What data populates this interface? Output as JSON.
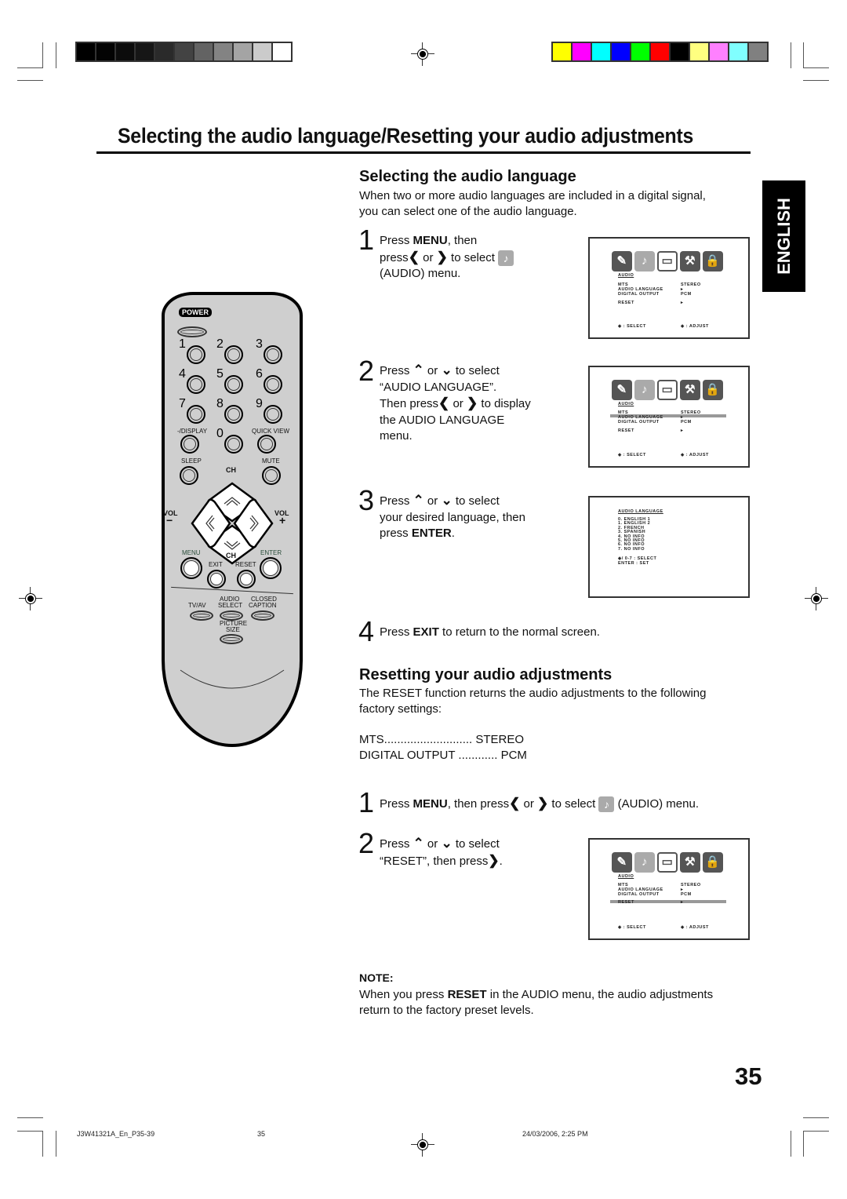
{
  "print_marks": {
    "grayscale_bar": [
      "#000000",
      "#030303",
      "#0c0c0c",
      "#161616",
      "#2a2a2a",
      "#434343",
      "#636363",
      "#838383",
      "#a4a4a4",
      "#cbcbcb",
      "#ffffff"
    ],
    "color_bar": [
      "#ffff00",
      "#ff00ff",
      "#00ffff",
      "#0000ff",
      "#00ff00",
      "#ff0000",
      "#000000",
      "#ffff80",
      "#ff80ff",
      "#80ffff",
      "#808080"
    ]
  },
  "page": {
    "title": "Selecting the audio language/Resetting your audio adjustments",
    "language_tab": "ENGLISH",
    "page_number": "35"
  },
  "section1": {
    "heading": "Selecting the audio language",
    "intro_line1": "When two or more audio languages are included in a digital signal,",
    "intro_line2": "you can select one of the audio language.",
    "steps": [
      {
        "num": "1",
        "l1a": "Press ",
        "l1b": "MENU",
        "l1c": ", then",
        "l2a": "press",
        "l2or": " or ",
        "l2b": " to select",
        "l3": "(AUDIO) menu."
      },
      {
        "num": "2",
        "l1a": "Press ",
        "l1or": " or ",
        "l1b": " to select",
        "l2": "“AUDIO LANGUAGE”.",
        "l3a": "Then press",
        "l3or": " or ",
        "l3b": " to display",
        "l4": "the AUDIO LANGUAGE",
        "l5": "menu."
      },
      {
        "num": "3",
        "l1a": "Press ",
        "l1or": " or ",
        "l1b": " to  select",
        "l2": "your desired language, then",
        "l3a": "press ",
        "l3b": "ENTER",
        "l3c": "."
      },
      {
        "num": "4",
        "l1a": "Press ",
        "l1b": "EXIT",
        "l1c": " to return to the normal screen."
      }
    ]
  },
  "section2": {
    "heading": "Resetting your audio adjustments",
    "intro_line1": "The RESET function returns the audio adjustments to the following",
    "intro_line2": "factory settings:",
    "settings": [
      {
        "name": "MTS",
        "dots": "...........................",
        "value": "STEREO"
      },
      {
        "name": "DIGITAL OUTPUT",
        "dots": " ............",
        "value": "PCM"
      }
    ],
    "steps": [
      {
        "num": "1",
        "a": "Press ",
        "b": "MENU",
        "c": ", then press",
        "or": " or ",
        "d": " to select ",
        "e": " (AUDIO) menu."
      },
      {
        "num": "2",
        "l1a": "Press ",
        "l1or": " or ",
        "l1b": " to select",
        "l2a": "“RESET”, then press",
        "l2b": "."
      }
    ],
    "note_label": "NOTE:",
    "note_a": "When you press ",
    "note_b": "RESET",
    "note_c": " in the AUDIO menu, the audio adjustments",
    "note_d": "return to the factory preset levels."
  },
  "osd_audio": {
    "title": "AUDIO",
    "rows": [
      {
        "label": "MTS",
        "value": "STEREO"
      },
      {
        "label": "AUDIO LANGUAGE",
        "value": "▸"
      },
      {
        "label": "DIGITAL OUTPUT",
        "value": "PCM"
      },
      {
        "label": "RESET",
        "value": "▸"
      }
    ],
    "select_hint": "◈ : SELECT",
    "adjust_hint": "◈ : ADJUST"
  },
  "osd_language": {
    "title": "AUDIO LANGUAGE",
    "options": [
      "0. ENGLISH 1",
      "1. ENGLISH 2",
      "2. FRENCH",
      "3. SPANISH",
      "4. NO INFO",
      "5. NO INFO",
      "6. NO INFO",
      "7. NO INFO"
    ],
    "select_hint": "◈/ 0-7 : SELECT",
    "set_hint": "ENTER : SET"
  },
  "remote": {
    "power": "POWER",
    "digits": [
      "1",
      "2",
      "3",
      "4",
      "5",
      "6",
      "7",
      "8",
      "9",
      "0"
    ],
    "display": "-/DISPLAY",
    "quick_view": "QUICK VIEW",
    "sleep": "SLEEP",
    "mute": "MUTE",
    "ch": "CH",
    "vol": "VOL",
    "vol_minus": "−",
    "vol_plus": "+",
    "menu": "MENU",
    "enter": "ENTER",
    "exit": "EXIT",
    "reset": "RESET",
    "tvav": "TV/AV",
    "audio_select_1": "AUDIO",
    "audio_select_2": "SELECT",
    "closed_caption_1": "CLOSED",
    "closed_caption_2": "CAPTION",
    "picture_size_1": "PICTURE",
    "picture_size_2": "SIZE"
  },
  "footer": {
    "file": "J3W41321A_En_P35-39",
    "page": "35",
    "datetime": "24/03/2006, 2:25 PM"
  }
}
